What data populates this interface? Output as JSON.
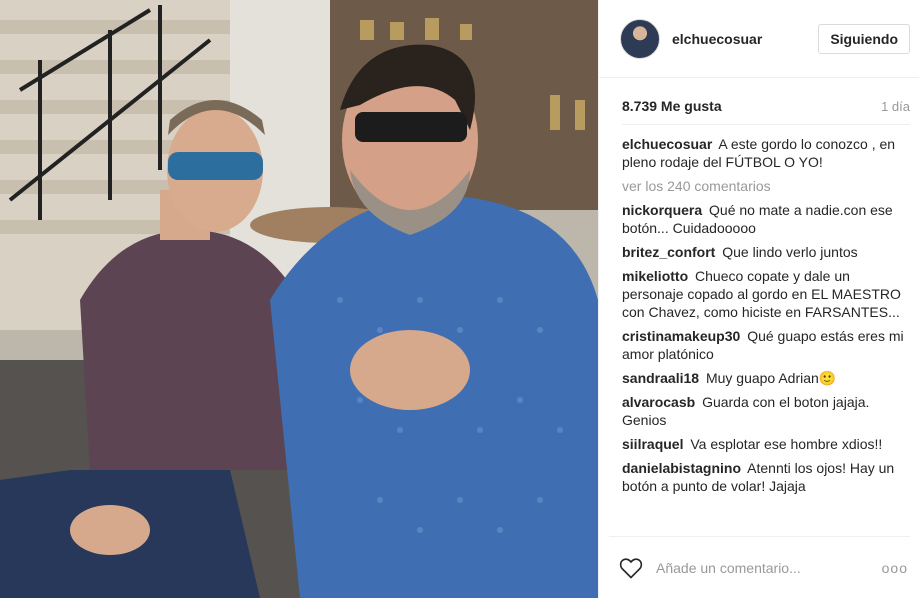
{
  "post": {
    "photo_alt": ""
  },
  "header": {
    "username": "elchuecosuar",
    "follow_label": "Siguiendo"
  },
  "stats": {
    "likes": "8.739 Me gusta",
    "time": "1 día"
  },
  "caption": {
    "user": "elchuecosuar",
    "text": "A este gordo lo conozco , en pleno rodaje del FÚTBOL O YO!"
  },
  "view_all": "ver los 240 comentarios",
  "comments": [
    {
      "user": "nickorquera",
      "text": "Qué no mate a nadie.con ese botón... Cuidadooooo"
    },
    {
      "user": "britez_confort",
      "text": "Que lindo verlo juntos"
    },
    {
      "user": "mikeliotto",
      "text": "Chueco copate y dale un personaje copado al gordo en EL MAESTRO con Chavez, como hiciste en FARSANTES..."
    },
    {
      "user": "cristinamakeup30",
      "text": "Qué guapo estás eres mi amor platónico"
    },
    {
      "user": "sandraali18",
      "text": "Muy guapo Adrian🙂"
    },
    {
      "user": "alvarocasb",
      "text": "Guarda con el boton jajaja. Genios"
    },
    {
      "user": "siilraquel",
      "text": "Va esplotar ese hombre xdios!!"
    },
    {
      "user": "danielabistagnino",
      "text": "Atennti los ojos! Hay un botón a punto de volar! Jajaja"
    }
  ],
  "footer": {
    "placeholder": "Añade un comentario...",
    "more": "ooo"
  },
  "icons": {
    "heart": "heart-outline-icon",
    "more": "more-options-icon"
  },
  "colors": {
    "text": "#262626",
    "muted": "#999999",
    "border": "#efefef"
  }
}
